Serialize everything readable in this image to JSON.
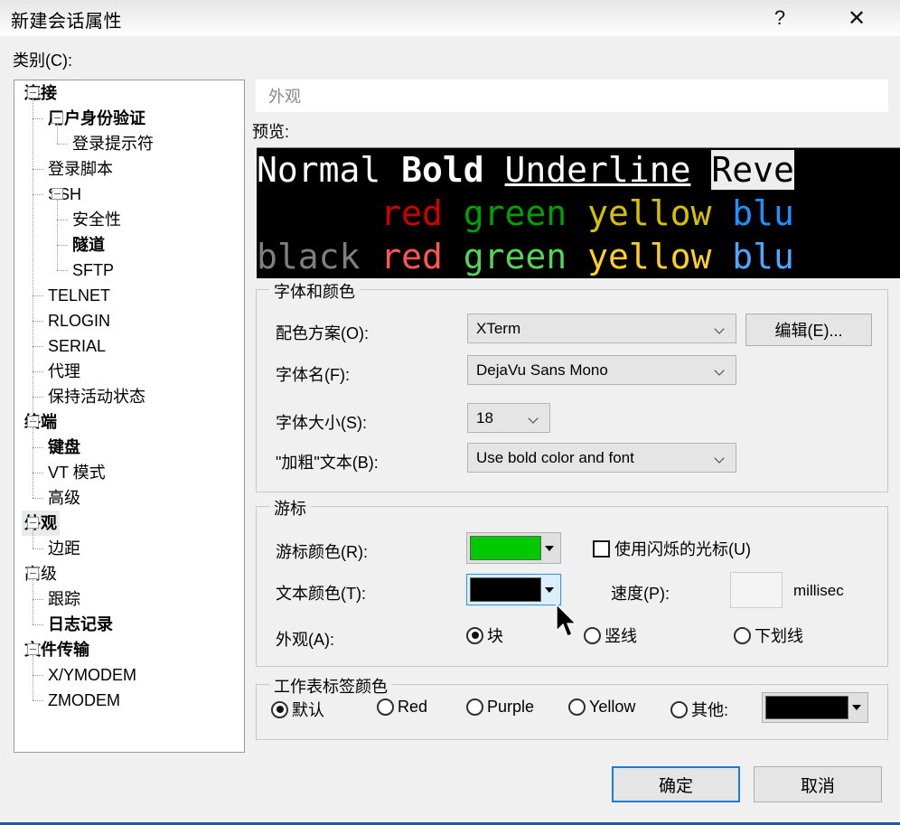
{
  "window": {
    "title": "新建会话属性",
    "help_icon": "?",
    "close_icon": "✕"
  },
  "category": {
    "label": "类别(C):",
    "tree": [
      {
        "label": "连接",
        "level": 0,
        "bold": true,
        "expandable": true,
        "selected": false
      },
      {
        "label": "用户身份验证",
        "level": 1,
        "bold": true,
        "expandable": true,
        "selected": false
      },
      {
        "label": "登录提示符",
        "level": 2,
        "bold": false,
        "expandable": false,
        "selected": false
      },
      {
        "label": "登录脚本",
        "level": 1,
        "bold": false,
        "expandable": false,
        "selected": false
      },
      {
        "label": "SSH",
        "level": 1,
        "bold": false,
        "expandable": true,
        "selected": false
      },
      {
        "label": "安全性",
        "level": 2,
        "bold": false,
        "expandable": false,
        "selected": false
      },
      {
        "label": "隧道",
        "level": 2,
        "bold": true,
        "expandable": false,
        "selected": false
      },
      {
        "label": "SFTP",
        "level": 2,
        "bold": false,
        "expandable": false,
        "selected": false
      },
      {
        "label": "TELNET",
        "level": 1,
        "bold": false,
        "expandable": false,
        "selected": false
      },
      {
        "label": "RLOGIN",
        "level": 1,
        "bold": false,
        "expandable": false,
        "selected": false
      },
      {
        "label": "SERIAL",
        "level": 1,
        "bold": false,
        "expandable": false,
        "selected": false
      },
      {
        "label": "代理",
        "level": 1,
        "bold": false,
        "expandable": false,
        "selected": false
      },
      {
        "label": "保持活动状态",
        "level": 1,
        "bold": false,
        "expandable": false,
        "selected": false
      },
      {
        "label": "终端",
        "level": 0,
        "bold": true,
        "expandable": true,
        "selected": false
      },
      {
        "label": "键盘",
        "level": 1,
        "bold": true,
        "expandable": false,
        "selected": false
      },
      {
        "label": "VT 模式",
        "level": 1,
        "bold": false,
        "expandable": false,
        "selected": false
      },
      {
        "label": "高级",
        "level": 1,
        "bold": false,
        "expandable": false,
        "selected": false
      },
      {
        "label": "外观",
        "level": 0,
        "bold": true,
        "expandable": true,
        "selected": true
      },
      {
        "label": "边距",
        "level": 1,
        "bold": false,
        "expandable": false,
        "selected": false
      },
      {
        "label": "高级",
        "level": 0,
        "bold": false,
        "expandable": true,
        "selected": false
      },
      {
        "label": "跟踪",
        "level": 1,
        "bold": false,
        "expandable": false,
        "selected": false
      },
      {
        "label": "日志记录",
        "level": 1,
        "bold": true,
        "expandable": false,
        "selected": false
      },
      {
        "label": "文件传输",
        "level": 0,
        "bold": true,
        "expandable": true,
        "selected": false
      },
      {
        "label": "X/YMODEM",
        "level": 1,
        "bold": false,
        "expandable": false,
        "selected": false
      },
      {
        "label": "ZMODEM",
        "level": 1,
        "bold": false,
        "expandable": false,
        "selected": false
      }
    ]
  },
  "page": {
    "header": "外观",
    "preview_label": "预览:",
    "preview": {
      "line1": [
        {
          "text": "Normal ",
          "style": "pv-normal"
        },
        {
          "text": "Bold ",
          "style": "pv-bold"
        },
        {
          "text": "Underline",
          "style": "pv-ul"
        },
        {
          "text": " ",
          "style": "pv-normal"
        },
        {
          "text": "Reve",
          "style": "pv-rev"
        }
      ],
      "line2": [
        {
          "text": "      red ",
          "style": "c-red"
        },
        {
          "text": "green ",
          "style": "c-green"
        },
        {
          "text": "yellow ",
          "style": "c-yellow"
        },
        {
          "text": "blu",
          "style": "c-blue"
        }
      ],
      "line3": [
        {
          "text": "black ",
          "style": "c-black"
        },
        {
          "text": "red ",
          "style": "cb-red"
        },
        {
          "text": "green ",
          "style": "cb-green"
        },
        {
          "text": "yellow ",
          "style": "cb-yellow"
        },
        {
          "text": "blu",
          "style": "cb-blue"
        }
      ]
    }
  },
  "font_and_color": {
    "group_title": "字体和颜色",
    "scheme_label": "配色方案(O):",
    "scheme_value": "XTerm",
    "edit_button": "编辑(E)...",
    "fontname_label": "字体名(F):",
    "fontname_value": "DejaVu Sans Mono",
    "fontsize_label": "字体大小(S):",
    "fontsize_value": "18",
    "bold_label": "\"加粗\"文本(B):",
    "bold_value": "Use bold color and font"
  },
  "cursor": {
    "group_title": "游标",
    "cursor_color_label": "游标颜色(R):",
    "cursor_color_value": "#00C900",
    "text_color_label": "文本颜色(T):",
    "text_color_value": "#000000",
    "blink_checkbox_label": "使用闪烁的光标(U)",
    "blink_checked": false,
    "speed_label": "速度(P):",
    "speed_value": "",
    "speed_unit": "millisec",
    "appearance_label": "外观(A):",
    "options": [
      {
        "label": "块",
        "selected": true
      },
      {
        "label": "竖线",
        "selected": false
      },
      {
        "label": "下划线",
        "selected": false
      }
    ]
  },
  "tab_color": {
    "group_title": "工作表标签颜色",
    "options": [
      {
        "label": "默认",
        "selected": true
      },
      {
        "label": "Red",
        "selected": false
      },
      {
        "label": "Purple",
        "selected": false
      },
      {
        "label": "Yellow",
        "selected": false
      },
      {
        "label": "其他:",
        "selected": false
      }
    ],
    "other_color_value": "#000000"
  },
  "buttons": {
    "ok": "确定",
    "cancel": "取消"
  }
}
